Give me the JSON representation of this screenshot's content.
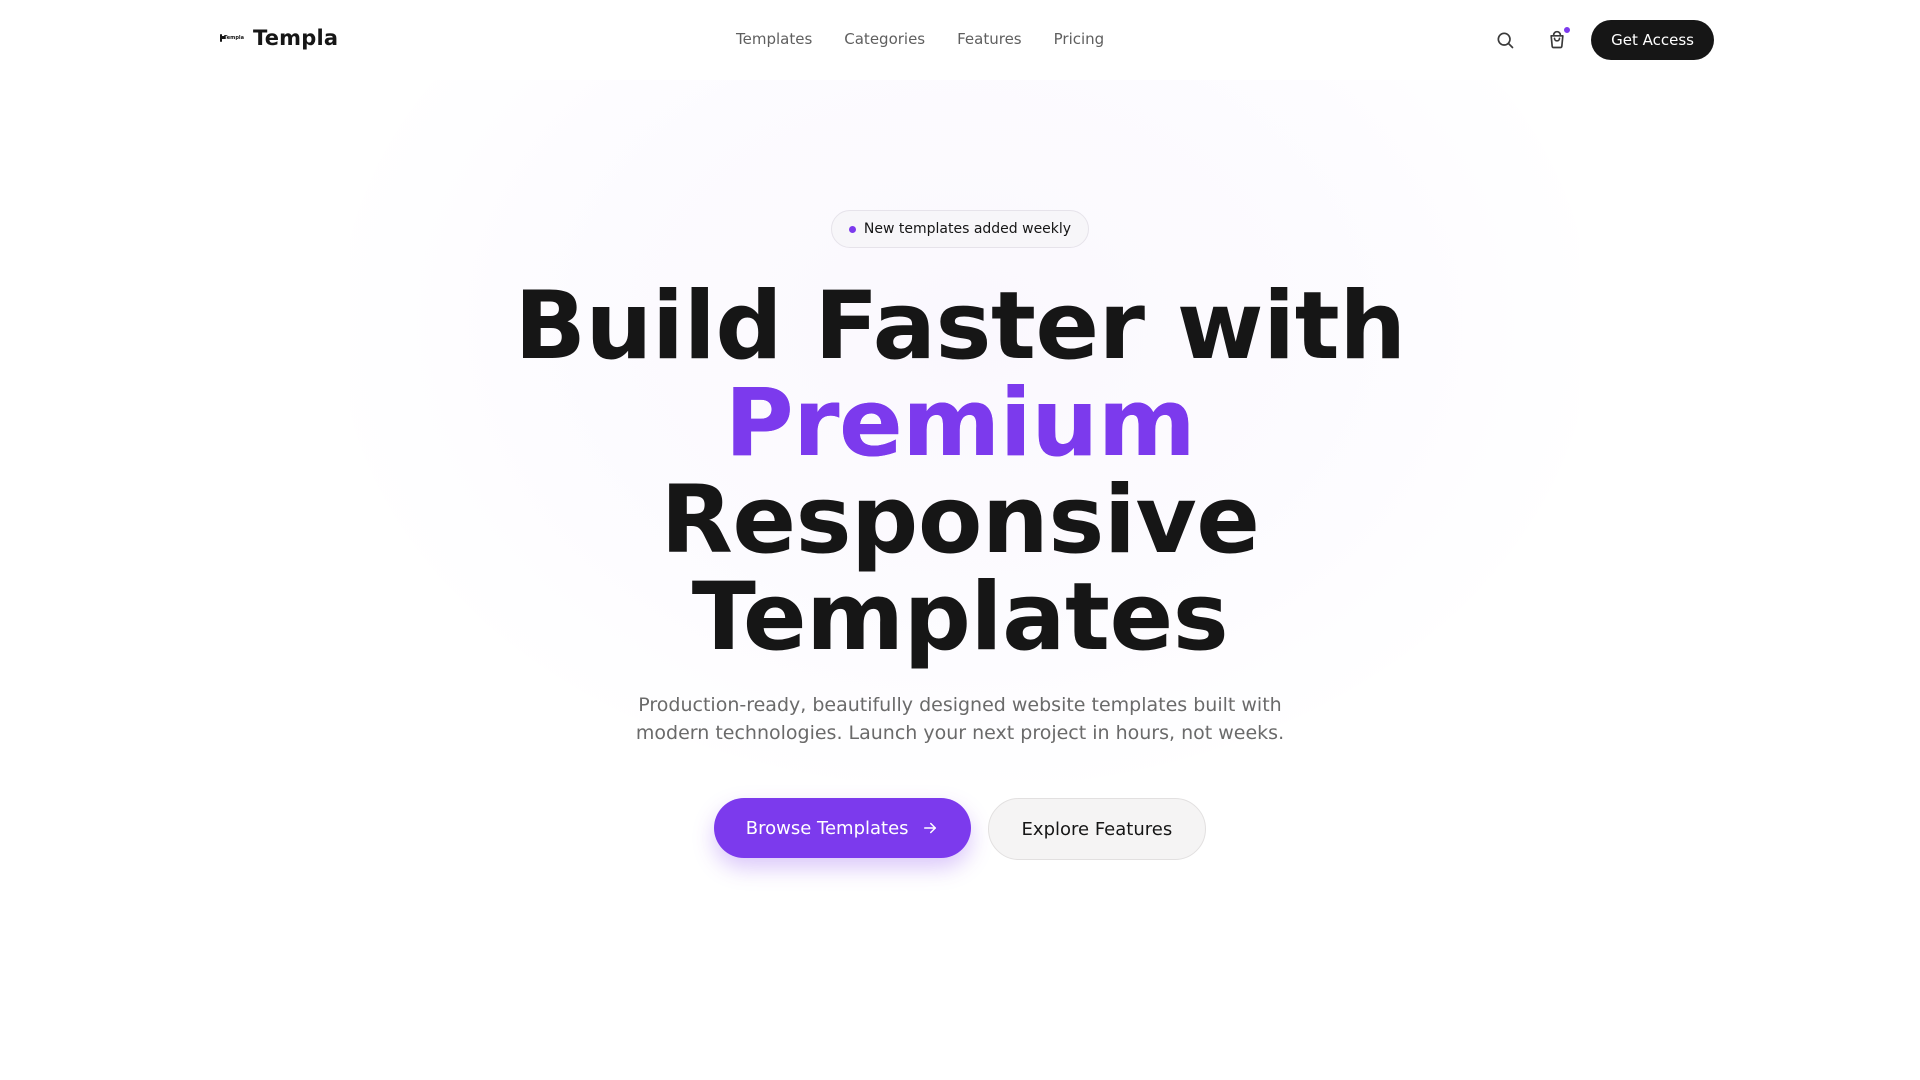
{
  "brand": {
    "name": "Templa",
    "mark_text": "Templa"
  },
  "nav": {
    "items": [
      {
        "label": "Templates"
      },
      {
        "label": "Categories"
      },
      {
        "label": "Features"
      },
      {
        "label": "Pricing"
      }
    ]
  },
  "header": {
    "search_icon": "search-icon",
    "cart_icon": "shopping-bag-icon",
    "cart_has_notification": true,
    "cta_label": "Get Access"
  },
  "hero": {
    "badge_text": "New templates added weekly",
    "headline": {
      "line1": "Build Faster with",
      "line2_accent": "Premium",
      "line3": "Responsive",
      "line4": "Templates"
    },
    "subtitle": "Production-ready, beautifully designed website templates built with modern technologies. Launch your next project in hours, not weeks.",
    "primary_cta": "Browse Templates",
    "primary_cta_icon": "arrow-right-icon",
    "secondary_cta": "Explore Features"
  },
  "colors": {
    "accent": "#7c3aed",
    "text": "#161616",
    "muted": "#6a6a6a",
    "background": "#ffffff"
  }
}
